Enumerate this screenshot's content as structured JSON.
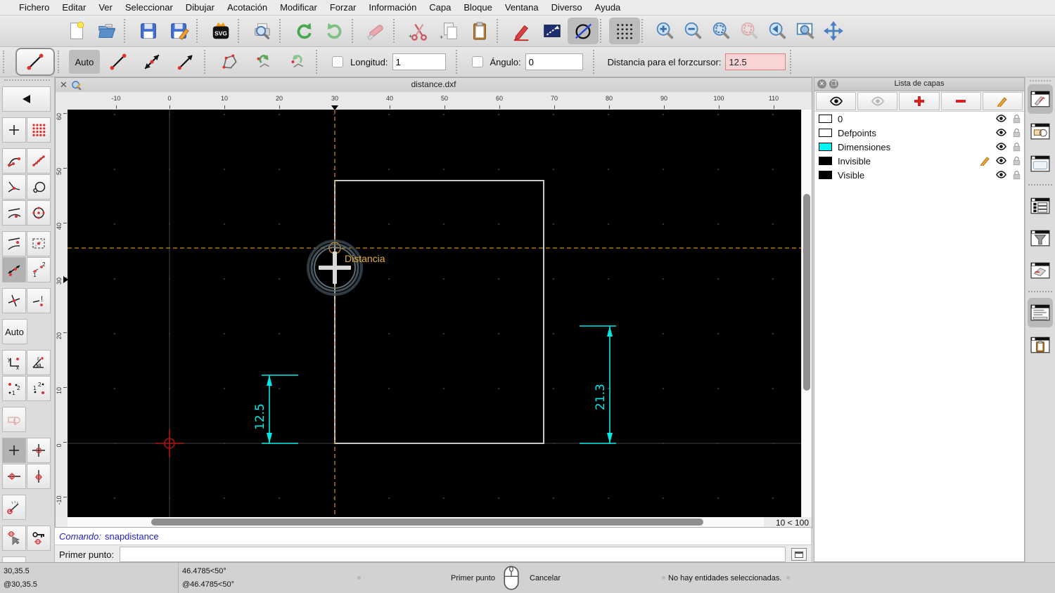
{
  "menubar": {
    "items": [
      "Fichero",
      "Editar",
      "Ver",
      "Seleccionar",
      "Dibujar",
      "Acotación",
      "Modificar",
      "Forzar",
      "Información",
      "Capa",
      "Bloque",
      "Ventana",
      "Diverso",
      "Ayuda"
    ]
  },
  "toolbar_main": {
    "icons": [
      "new-file",
      "open-file",
      "save",
      "save-as",
      "svg-export",
      "print-preview",
      "undo",
      "redo",
      "eraser",
      "cut",
      "copy",
      "paste",
      "draw-pen",
      "draft-mode",
      "round-off",
      "grid-toggle",
      "zoom-in",
      "zoom-out",
      "zoom-auto",
      "zoom-selection",
      "zoom-previous",
      "zoom-window",
      "zoom-pan"
    ]
  },
  "options_toolbar": {
    "auto_label": "Auto",
    "length_label": "Longitud:",
    "length_value": "1",
    "angle_label": "Ángulo:",
    "angle_value": "0",
    "snap_distance_label": "Distancia para el forzcursor:",
    "snap_distance_value": "12.5"
  },
  "left_palette": {
    "auto_label": "Auto"
  },
  "drawing": {
    "title": "distance.dxf",
    "h_ruler": [
      "-10",
      "0",
      "10",
      "20",
      "30",
      "40",
      "50",
      "60",
      "70",
      "80",
      "90",
      "100",
      "110"
    ],
    "v_ruler": [
      "60",
      "50",
      "40",
      "30",
      "20",
      "10",
      "0",
      "-10"
    ],
    "tooltip": "Distancia",
    "dim_left": "12.5",
    "dim_right": "21.3",
    "zoom_indicator": "10 < 100"
  },
  "command": {
    "history_label": "Comando:",
    "history_value": "snapdistance",
    "prompt_label": "Primer punto:",
    "prompt_value": ""
  },
  "layers_panel": {
    "title": "Lista de capas",
    "toolbar_icons": [
      "show-all-layers",
      "hide-all-layers",
      "add-layer",
      "remove-layer",
      "edit-layer"
    ],
    "items": [
      {
        "name": "0",
        "color": "#ffffff"
      },
      {
        "name": "Defpoints",
        "color": "#ffffff"
      },
      {
        "name": "Dimensiones",
        "color": "#00f5f5"
      },
      {
        "name": "Invisible",
        "color": "#000000",
        "current": true
      },
      {
        "name": "Visible",
        "color": "#000000"
      }
    ]
  },
  "dock_strip": {
    "icons": [
      "dock-layer-list",
      "dock-block-list",
      "dock-library-browser",
      "dock-command-options",
      "dock-selection-filter",
      "dock-pen-palette",
      "dock-command-line",
      "dock-clipboard"
    ]
  },
  "statusbar": {
    "abs_coord": "30,35.5",
    "rel_coord": "@30,35.5",
    "abs_polar": "46.4785<50°",
    "rel_polar": "@46.4785<50°",
    "left_mouse": "Primer punto",
    "right_mouse": "Cancelar",
    "selection": "No hay entidades seleccionadas."
  },
  "colors": {
    "crosshair_orange": "#cf8a1e",
    "dimension_cyan": "#00e8e8",
    "tooltip_yellow": "#e7b229",
    "highlight_field_pink": "#f9d4d4",
    "command_blue": "#2222cc",
    "origin_marker_red": "#aa1111",
    "entity_gray": "#c8c8c8"
  }
}
